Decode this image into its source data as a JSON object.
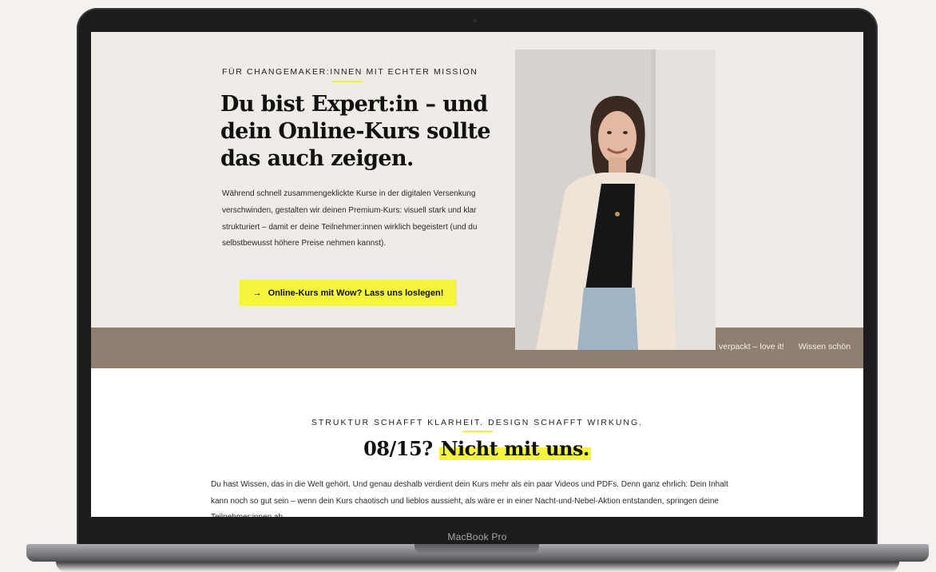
{
  "device": {
    "label": "MacBook Pro"
  },
  "hero": {
    "eyebrow": "FÜR CHANGEMAKER:INNEN MIT ECHTER MISSION",
    "headline": "Du bist Expert:in – und dein Online-Kurs sollte das auch zeigen.",
    "body": "Während schnell zusammengeklickte Kurse in der digitalen Versenkung verschwinden, gestalten wir deinen Premium-Kurs: visuell stark und klar strukturiert – damit er deine Teilnehmer:innen wirklich begeistert (und du selbstbewusst höhere Preise nehmen kannst).",
    "cta_arrow": "→",
    "cta_label": "Online-Kurs mit Wow? Lass uns loslegen!"
  },
  "ticker": {
    "items": [
      "verpackt – love it!",
      "Wissen schön"
    ]
  },
  "section2": {
    "eyebrow": "STRUKTUR SCHAFFT KLARHEIT. DESIGN SCHAFFT WIRKUNG.",
    "title_prefix": "08/15?",
    "title_highlight": "Nicht mit uns.",
    "body": "Du hast Wissen, das in die Welt gehört. Und genau deshalb verdient dein Kurs mehr als ein paar Videos und PDFs. Denn ganz ehrlich: Dein Inhalt kann noch so gut sein – wenn dein Kurs chaotisch und lieblos aussieht, als wäre er in einer Nacht-und-Nebel-Aktion entstanden, springen deine Teilnehmer:innen ab."
  },
  "colors": {
    "accent": "#f5f53b",
    "hero_bg": "#efebe7",
    "ticker_bg": "#8f7f70"
  }
}
